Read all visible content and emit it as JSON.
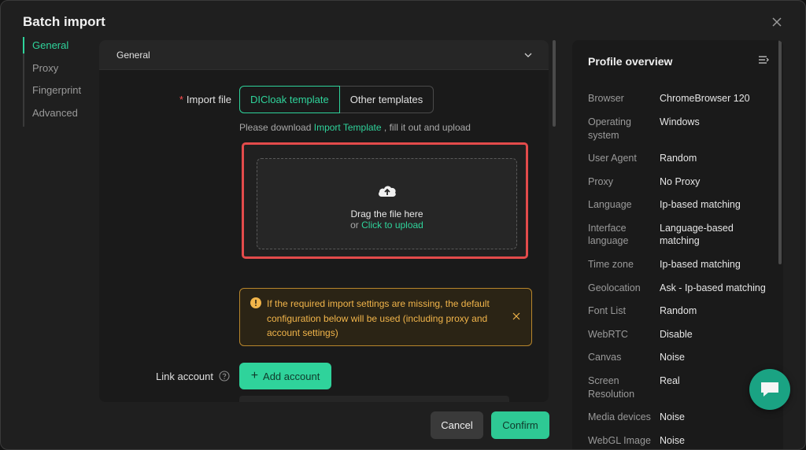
{
  "dialog": {
    "title": "Batch import"
  },
  "nav": {
    "items": [
      "General",
      "Proxy",
      "Fingerprint",
      "Advanced"
    ]
  },
  "section": {
    "title": "General"
  },
  "import": {
    "required_mark": "*",
    "label": "Import file",
    "template_options": [
      "DICloak template",
      "Other templates"
    ],
    "selected_template": "DICloak template",
    "hint_prefix": "Please download ",
    "hint_link": "Import Template",
    "hint_suffix": " , fill it out and upload",
    "drop_title": "Drag the file here",
    "drop_or": "or ",
    "drop_link": "Click to upload"
  },
  "warning": {
    "text": "If the required import settings are missing, the default configuration below will be used (including proxy and account settings)"
  },
  "link_account": {
    "label": "Link account",
    "add_button": "Add account"
  },
  "footer": {
    "cancel": "Cancel",
    "confirm": "Confirm"
  },
  "overview": {
    "title": "Profile overview",
    "rows": [
      {
        "key": "Browser",
        "value": "ChromeBrowser 120"
      },
      {
        "key": "Operating system",
        "value": "Windows"
      },
      {
        "key": "User Agent",
        "value": "Random"
      },
      {
        "key": "Proxy",
        "value": "No Proxy"
      },
      {
        "key": "Language",
        "value": "Ip-based matching"
      },
      {
        "key": "Interface language",
        "value": "Language-based matching"
      },
      {
        "key": "Time zone",
        "value": "Ip-based matching"
      },
      {
        "key": "Geolocation",
        "value": "Ask - Ip-based matching"
      },
      {
        "key": "Font List",
        "value": "Random"
      },
      {
        "key": "WebRTC",
        "value": "Disable"
      },
      {
        "key": "Canvas",
        "value": "Noise"
      },
      {
        "key": "Screen Resolution",
        "value": "Real"
      },
      {
        "key": "Media devices",
        "value": "Noise"
      },
      {
        "key": "WebGL Image",
        "value": "Noise"
      }
    ]
  },
  "colors": {
    "accent": "#2fd39b",
    "warning": "#f2b54a",
    "highlight": "#e34b4b"
  }
}
